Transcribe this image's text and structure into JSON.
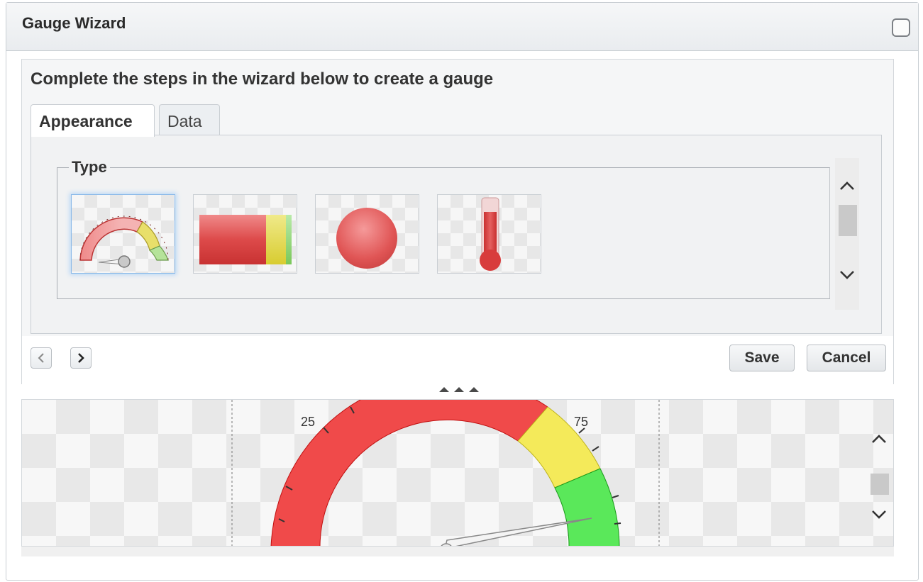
{
  "dialog": {
    "title": "Gauge Wizard"
  },
  "wizard": {
    "instructions": "Complete the steps in the wizard below to create a gauge",
    "tabs": [
      {
        "label": "Appearance",
        "active": true
      },
      {
        "label": "Data",
        "active": false
      }
    ],
    "type_section": {
      "legend": "Type",
      "options": [
        {
          "name": "radial-gauge",
          "icon": "radial-gauge-icon",
          "selected": true
        },
        {
          "name": "linear-bar-gauge",
          "icon": "linear-bar-gauge-icon",
          "selected": false
        },
        {
          "name": "circle-indicator",
          "icon": "circle-indicator-icon",
          "selected": false
        },
        {
          "name": "thermometer-gauge",
          "icon": "thermometer-gauge-icon",
          "selected": false
        }
      ]
    },
    "buttons": {
      "save": "Save",
      "cancel": "Cancel"
    }
  },
  "preview": {
    "tick_labels": [
      "25",
      "75"
    ],
    "range_colors": {
      "red": "#e8191b",
      "yellow": "#efe22c",
      "green": "#2fdc2f"
    }
  }
}
